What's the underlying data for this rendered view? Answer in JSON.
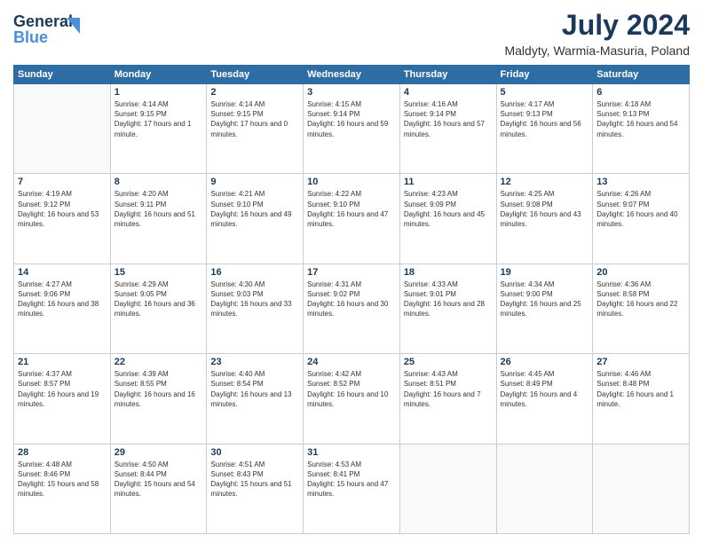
{
  "header": {
    "logo_line1": "General",
    "logo_line2": "Blue",
    "month_year": "July 2024",
    "location": "Maldyty, Warmia-Masuria, Poland"
  },
  "days_of_week": [
    "Sunday",
    "Monday",
    "Tuesday",
    "Wednesday",
    "Thursday",
    "Friday",
    "Saturday"
  ],
  "weeks": [
    [
      {
        "num": "",
        "sunrise": "",
        "sunset": "",
        "daylight": ""
      },
      {
        "num": "1",
        "sunrise": "Sunrise: 4:14 AM",
        "sunset": "Sunset: 9:15 PM",
        "daylight": "Daylight: 17 hours and 1 minute."
      },
      {
        "num": "2",
        "sunrise": "Sunrise: 4:14 AM",
        "sunset": "Sunset: 9:15 PM",
        "daylight": "Daylight: 17 hours and 0 minutes."
      },
      {
        "num": "3",
        "sunrise": "Sunrise: 4:15 AM",
        "sunset": "Sunset: 9:14 PM",
        "daylight": "Daylight: 16 hours and 59 minutes."
      },
      {
        "num": "4",
        "sunrise": "Sunrise: 4:16 AM",
        "sunset": "Sunset: 9:14 PM",
        "daylight": "Daylight: 16 hours and 57 minutes."
      },
      {
        "num": "5",
        "sunrise": "Sunrise: 4:17 AM",
        "sunset": "Sunset: 9:13 PM",
        "daylight": "Daylight: 16 hours and 56 minutes."
      },
      {
        "num": "6",
        "sunrise": "Sunrise: 4:18 AM",
        "sunset": "Sunset: 9:13 PM",
        "daylight": "Daylight: 16 hours and 54 minutes."
      }
    ],
    [
      {
        "num": "7",
        "sunrise": "Sunrise: 4:19 AM",
        "sunset": "Sunset: 9:12 PM",
        "daylight": "Daylight: 16 hours and 53 minutes."
      },
      {
        "num": "8",
        "sunrise": "Sunrise: 4:20 AM",
        "sunset": "Sunset: 9:11 PM",
        "daylight": "Daylight: 16 hours and 51 minutes."
      },
      {
        "num": "9",
        "sunrise": "Sunrise: 4:21 AM",
        "sunset": "Sunset: 9:10 PM",
        "daylight": "Daylight: 16 hours and 49 minutes."
      },
      {
        "num": "10",
        "sunrise": "Sunrise: 4:22 AM",
        "sunset": "Sunset: 9:10 PM",
        "daylight": "Daylight: 16 hours and 47 minutes."
      },
      {
        "num": "11",
        "sunrise": "Sunrise: 4:23 AM",
        "sunset": "Sunset: 9:09 PM",
        "daylight": "Daylight: 16 hours and 45 minutes."
      },
      {
        "num": "12",
        "sunrise": "Sunrise: 4:25 AM",
        "sunset": "Sunset: 9:08 PM",
        "daylight": "Daylight: 16 hours and 43 minutes."
      },
      {
        "num": "13",
        "sunrise": "Sunrise: 4:26 AM",
        "sunset": "Sunset: 9:07 PM",
        "daylight": "Daylight: 16 hours and 40 minutes."
      }
    ],
    [
      {
        "num": "14",
        "sunrise": "Sunrise: 4:27 AM",
        "sunset": "Sunset: 9:06 PM",
        "daylight": "Daylight: 16 hours and 38 minutes."
      },
      {
        "num": "15",
        "sunrise": "Sunrise: 4:29 AM",
        "sunset": "Sunset: 9:05 PM",
        "daylight": "Daylight: 16 hours and 36 minutes."
      },
      {
        "num": "16",
        "sunrise": "Sunrise: 4:30 AM",
        "sunset": "Sunset: 9:03 PM",
        "daylight": "Daylight: 16 hours and 33 minutes."
      },
      {
        "num": "17",
        "sunrise": "Sunrise: 4:31 AM",
        "sunset": "Sunset: 9:02 PM",
        "daylight": "Daylight: 16 hours and 30 minutes."
      },
      {
        "num": "18",
        "sunrise": "Sunrise: 4:33 AM",
        "sunset": "Sunset: 9:01 PM",
        "daylight": "Daylight: 16 hours and 28 minutes."
      },
      {
        "num": "19",
        "sunrise": "Sunrise: 4:34 AM",
        "sunset": "Sunset: 9:00 PM",
        "daylight": "Daylight: 16 hours and 25 minutes."
      },
      {
        "num": "20",
        "sunrise": "Sunrise: 4:36 AM",
        "sunset": "Sunset: 8:58 PM",
        "daylight": "Daylight: 16 hours and 22 minutes."
      }
    ],
    [
      {
        "num": "21",
        "sunrise": "Sunrise: 4:37 AM",
        "sunset": "Sunset: 8:57 PM",
        "daylight": "Daylight: 16 hours and 19 minutes."
      },
      {
        "num": "22",
        "sunrise": "Sunrise: 4:39 AM",
        "sunset": "Sunset: 8:55 PM",
        "daylight": "Daylight: 16 hours and 16 minutes."
      },
      {
        "num": "23",
        "sunrise": "Sunrise: 4:40 AM",
        "sunset": "Sunset: 8:54 PM",
        "daylight": "Daylight: 16 hours and 13 minutes."
      },
      {
        "num": "24",
        "sunrise": "Sunrise: 4:42 AM",
        "sunset": "Sunset: 8:52 PM",
        "daylight": "Daylight: 16 hours and 10 minutes."
      },
      {
        "num": "25",
        "sunrise": "Sunrise: 4:43 AM",
        "sunset": "Sunset: 8:51 PM",
        "daylight": "Daylight: 16 hours and 7 minutes."
      },
      {
        "num": "26",
        "sunrise": "Sunrise: 4:45 AM",
        "sunset": "Sunset: 8:49 PM",
        "daylight": "Daylight: 16 hours and 4 minutes."
      },
      {
        "num": "27",
        "sunrise": "Sunrise: 4:46 AM",
        "sunset": "Sunset: 8:48 PM",
        "daylight": "Daylight: 16 hours and 1 minute."
      }
    ],
    [
      {
        "num": "28",
        "sunrise": "Sunrise: 4:48 AM",
        "sunset": "Sunset: 8:46 PM",
        "daylight": "Daylight: 15 hours and 58 minutes."
      },
      {
        "num": "29",
        "sunrise": "Sunrise: 4:50 AM",
        "sunset": "Sunset: 8:44 PM",
        "daylight": "Daylight: 15 hours and 54 minutes."
      },
      {
        "num": "30",
        "sunrise": "Sunrise: 4:51 AM",
        "sunset": "Sunset: 8:43 PM",
        "daylight": "Daylight: 15 hours and 51 minutes."
      },
      {
        "num": "31",
        "sunrise": "Sunrise: 4:53 AM",
        "sunset": "Sunset: 8:41 PM",
        "daylight": "Daylight: 15 hours and 47 minutes."
      },
      {
        "num": "",
        "sunrise": "",
        "sunset": "",
        "daylight": ""
      },
      {
        "num": "",
        "sunrise": "",
        "sunset": "",
        "daylight": ""
      },
      {
        "num": "",
        "sunrise": "",
        "sunset": "",
        "daylight": ""
      }
    ]
  ]
}
